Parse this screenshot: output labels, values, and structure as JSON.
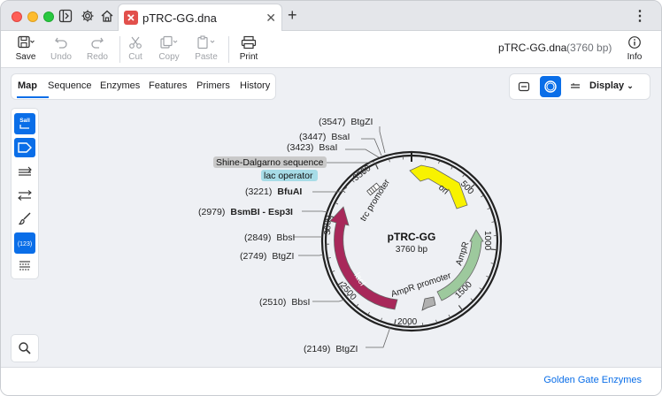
{
  "tab": {
    "title": "pTRC-GG.dna"
  },
  "toolbar": {
    "save": "Save",
    "undo": "Undo",
    "redo": "Redo",
    "cut": "Cut",
    "copy": "Copy",
    "paste": "Paste",
    "print": "Print",
    "info": "Info"
  },
  "file": {
    "name": "pTRC-GG.dna",
    "length": "(3760 bp)"
  },
  "view_tabs": [
    "Map",
    "Sequence",
    "Enzymes",
    "Features",
    "Primers",
    "History"
  ],
  "display_label": "Display",
  "left_panel": {
    "enzyme_icon_text": "SalI",
    "numbers_icon_text": "(123)"
  },
  "map": {
    "name": "pTRC-GG",
    "length": "3760 bp",
    "ticks": [
      "500",
      "1000",
      "1500",
      "2000",
      "2500",
      "3000",
      "3500"
    ],
    "features": [
      {
        "label": "ori",
        "color": "#f8f200"
      },
      {
        "label": "AmpR",
        "color": "#9dc99d"
      },
      {
        "label": "lacI",
        "color": "#a8285a"
      },
      {
        "label": "trc promoter",
        "color": "#ffffff"
      },
      {
        "label": "AmpR promoter",
        "color": "#b0b0b0"
      }
    ],
    "highlighted_labels": [
      {
        "text": "Shine-Dalgarno sequence",
        "bg": "#c9c9c9"
      },
      {
        "text": "lac operator",
        "bg": "#a7dce7"
      }
    ],
    "sites": [
      {
        "pos": "(3547)",
        "name": "BtgZI",
        "bold": false
      },
      {
        "pos": "(3447)",
        "name": "BsaI",
        "bold": false
      },
      {
        "pos": "(3423)",
        "name": "BsaI",
        "bold": false
      },
      {
        "pos": "(3221)",
        "name": "BfuAI",
        "bold": true
      },
      {
        "pos": "(2979)",
        "name": "BsmBI - Esp3I",
        "bold": true
      },
      {
        "pos": "(2849)",
        "name": "BbsI",
        "bold": false
      },
      {
        "pos": "(2749)",
        "name": "BtgZI",
        "bold": false
      },
      {
        "pos": "(2510)",
        "name": "BbsI",
        "bold": false
      },
      {
        "pos": "(2149)",
        "name": "BtgZI",
        "bold": false
      }
    ]
  },
  "footer": {
    "link": "Golden Gate Enzymes"
  }
}
